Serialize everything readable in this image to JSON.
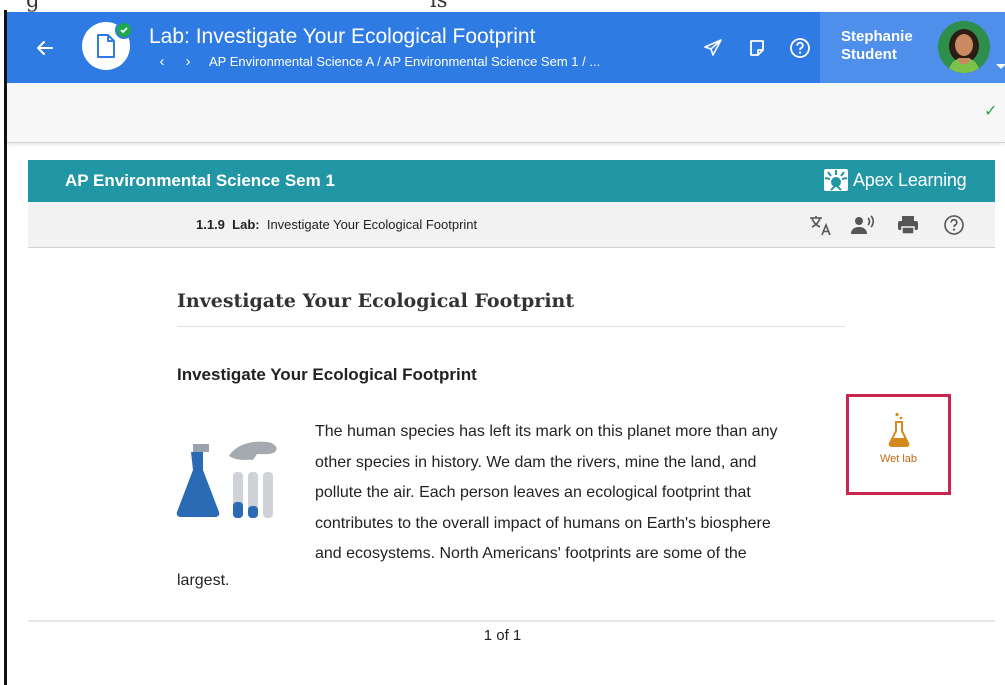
{
  "top_strip": {
    "left_text": "g",
    "right_text": "ls"
  },
  "header": {
    "title": "Lab: Investigate Your Ecological Footprint",
    "breadcrumb": "AP Environmental Science A / AP Environmental Science Sem 1 / ...",
    "prev_glyph": "‹",
    "next_glyph": "›",
    "user_name_line1": "Stephanie",
    "user_name_line2": "Student",
    "icons": [
      "back-arrow-icon",
      "document-icon",
      "send-icon",
      "notes-icon",
      "help-icon"
    ]
  },
  "toolbar": {
    "saved_check": "✓"
  },
  "course": {
    "title": "AP Environmental Science Sem 1",
    "brand": "Apex Learning"
  },
  "lesson": {
    "number": "1.1.9",
    "type_label": "Lab:",
    "title": "Investigate Your Ecological Footprint",
    "tools": [
      "translate-icon",
      "read-aloud-icon",
      "print-icon",
      "help-icon"
    ]
  },
  "content": {
    "page_heading": "Investigate Your Ecological Footprint",
    "section_heading": "Investigate Your Ecological Footprint",
    "body_lines": [
      "The human species has left its mark on this planet more than any",
      "other species in history. We dam the rivers, mine the land, and",
      "pollute the air. Each person leaves an ecological footprint that",
      "contributes to the overall impact of humans on Earth's biosphere",
      "and ecosystems. North Americans' footprints are some of the"
    ],
    "body_tail": "largest.",
    "wet_lab_label": "Wet lab"
  },
  "footer": {
    "pager": "1 of 1"
  },
  "colors": {
    "header_blue": "#2f7be4",
    "user_block_blue": "#4e8fec",
    "course_teal": "#2196a5",
    "wet_lab_border": "#c8254f",
    "wet_lab_orange": "#d4891c"
  }
}
